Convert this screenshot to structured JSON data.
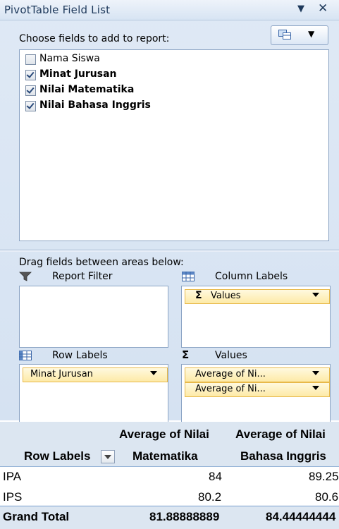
{
  "pane": {
    "title": "PivotTable Field List",
    "title_dropdown": "▼",
    "title_close": "✕",
    "choose_label": "Choose fields to add to report:",
    "fields": [
      {
        "label": "Nama Siswa",
        "checked": false
      },
      {
        "label": "Minat Jurusan",
        "checked": true
      },
      {
        "label": "Nilai Matematika",
        "checked": true
      },
      {
        "label": "Nilai Bahasa Inggris",
        "checked": true
      }
    ],
    "drag_label": "Drag fields between areas below:",
    "areas": {
      "report_filter": {
        "label": "Report Filter",
        "icon": "filter-icon",
        "items": []
      },
      "column_labels": {
        "label": "Column Labels",
        "icon": "column-grid-icon",
        "items": [
          "Values"
        ]
      },
      "row_labels": {
        "label": "Row Labels",
        "icon": "row-grid-icon",
        "items": [
          "Minat Jurusan"
        ]
      },
      "values": {
        "label": "Values",
        "icon": "sigma-icon",
        "items": [
          "Average of Ni...",
          "Average of Ni..."
        ]
      }
    },
    "sigma": "Σ"
  },
  "pivot": {
    "header": {
      "col1_line1": "Average of Nilai",
      "col1_line2": "Matematika",
      "col2_line1": "Average of Nilai",
      "col2_line2": "Bahasa Inggris",
      "row_labels": "Row Labels"
    },
    "rows": [
      {
        "label": "IPA",
        "v1": "84",
        "v2": "89.25"
      },
      {
        "label": "IPS",
        "v1": "80.2",
        "v2": "80.6"
      }
    ],
    "grand_total": {
      "label": "Grand Total",
      "v1": "81.88888889",
      "v2": "84.44444444"
    }
  },
  "colors": {
    "accent": "#1e395b",
    "chip_border": "#e8b94a",
    "header_fill": "#dce6f1"
  }
}
